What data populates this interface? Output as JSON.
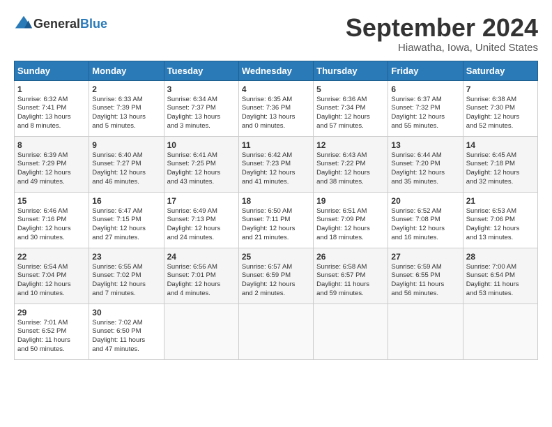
{
  "header": {
    "logo_general": "General",
    "logo_blue": "Blue",
    "month": "September 2024",
    "location": "Hiawatha, Iowa, United States"
  },
  "weekdays": [
    "Sunday",
    "Monday",
    "Tuesday",
    "Wednesday",
    "Thursday",
    "Friday",
    "Saturday"
  ],
  "weeks": [
    [
      {
        "day": "1",
        "line1": "Sunrise: 6:32 AM",
        "line2": "Sunset: 7:41 PM",
        "line3": "Daylight: 13 hours",
        "line4": "and 8 minutes."
      },
      {
        "day": "2",
        "line1": "Sunrise: 6:33 AM",
        "line2": "Sunset: 7:39 PM",
        "line3": "Daylight: 13 hours",
        "line4": "and 5 minutes."
      },
      {
        "day": "3",
        "line1": "Sunrise: 6:34 AM",
        "line2": "Sunset: 7:37 PM",
        "line3": "Daylight: 13 hours",
        "line4": "and 3 minutes."
      },
      {
        "day": "4",
        "line1": "Sunrise: 6:35 AM",
        "line2": "Sunset: 7:36 PM",
        "line3": "Daylight: 13 hours",
        "line4": "and 0 minutes."
      },
      {
        "day": "5",
        "line1": "Sunrise: 6:36 AM",
        "line2": "Sunset: 7:34 PM",
        "line3": "Daylight: 12 hours",
        "line4": "and 57 minutes."
      },
      {
        "day": "6",
        "line1": "Sunrise: 6:37 AM",
        "line2": "Sunset: 7:32 PM",
        "line3": "Daylight: 12 hours",
        "line4": "and 55 minutes."
      },
      {
        "day": "7",
        "line1": "Sunrise: 6:38 AM",
        "line2": "Sunset: 7:30 PM",
        "line3": "Daylight: 12 hours",
        "line4": "and 52 minutes."
      }
    ],
    [
      {
        "day": "8",
        "line1": "Sunrise: 6:39 AM",
        "line2": "Sunset: 7:29 PM",
        "line3": "Daylight: 12 hours",
        "line4": "and 49 minutes."
      },
      {
        "day": "9",
        "line1": "Sunrise: 6:40 AM",
        "line2": "Sunset: 7:27 PM",
        "line3": "Daylight: 12 hours",
        "line4": "and 46 minutes."
      },
      {
        "day": "10",
        "line1": "Sunrise: 6:41 AM",
        "line2": "Sunset: 7:25 PM",
        "line3": "Daylight: 12 hours",
        "line4": "and 43 minutes."
      },
      {
        "day": "11",
        "line1": "Sunrise: 6:42 AM",
        "line2": "Sunset: 7:23 PM",
        "line3": "Daylight: 12 hours",
        "line4": "and 41 minutes."
      },
      {
        "day": "12",
        "line1": "Sunrise: 6:43 AM",
        "line2": "Sunset: 7:22 PM",
        "line3": "Daylight: 12 hours",
        "line4": "and 38 minutes."
      },
      {
        "day": "13",
        "line1": "Sunrise: 6:44 AM",
        "line2": "Sunset: 7:20 PM",
        "line3": "Daylight: 12 hours",
        "line4": "and 35 minutes."
      },
      {
        "day": "14",
        "line1": "Sunrise: 6:45 AM",
        "line2": "Sunset: 7:18 PM",
        "line3": "Daylight: 12 hours",
        "line4": "and 32 minutes."
      }
    ],
    [
      {
        "day": "15",
        "line1": "Sunrise: 6:46 AM",
        "line2": "Sunset: 7:16 PM",
        "line3": "Daylight: 12 hours",
        "line4": "and 30 minutes."
      },
      {
        "day": "16",
        "line1": "Sunrise: 6:47 AM",
        "line2": "Sunset: 7:15 PM",
        "line3": "Daylight: 12 hours",
        "line4": "and 27 minutes."
      },
      {
        "day": "17",
        "line1": "Sunrise: 6:49 AM",
        "line2": "Sunset: 7:13 PM",
        "line3": "Daylight: 12 hours",
        "line4": "and 24 minutes."
      },
      {
        "day": "18",
        "line1": "Sunrise: 6:50 AM",
        "line2": "Sunset: 7:11 PM",
        "line3": "Daylight: 12 hours",
        "line4": "and 21 minutes."
      },
      {
        "day": "19",
        "line1": "Sunrise: 6:51 AM",
        "line2": "Sunset: 7:09 PM",
        "line3": "Daylight: 12 hours",
        "line4": "and 18 minutes."
      },
      {
        "day": "20",
        "line1": "Sunrise: 6:52 AM",
        "line2": "Sunset: 7:08 PM",
        "line3": "Daylight: 12 hours",
        "line4": "and 16 minutes."
      },
      {
        "day": "21",
        "line1": "Sunrise: 6:53 AM",
        "line2": "Sunset: 7:06 PM",
        "line3": "Daylight: 12 hours",
        "line4": "and 13 minutes."
      }
    ],
    [
      {
        "day": "22",
        "line1": "Sunrise: 6:54 AM",
        "line2": "Sunset: 7:04 PM",
        "line3": "Daylight: 12 hours",
        "line4": "and 10 minutes."
      },
      {
        "day": "23",
        "line1": "Sunrise: 6:55 AM",
        "line2": "Sunset: 7:02 PM",
        "line3": "Daylight: 12 hours",
        "line4": "and 7 minutes."
      },
      {
        "day": "24",
        "line1": "Sunrise: 6:56 AM",
        "line2": "Sunset: 7:01 PM",
        "line3": "Daylight: 12 hours",
        "line4": "and 4 minutes."
      },
      {
        "day": "25",
        "line1": "Sunrise: 6:57 AM",
        "line2": "Sunset: 6:59 PM",
        "line3": "Daylight: 12 hours",
        "line4": "and 2 minutes."
      },
      {
        "day": "26",
        "line1": "Sunrise: 6:58 AM",
        "line2": "Sunset: 6:57 PM",
        "line3": "Daylight: 11 hours",
        "line4": "and 59 minutes."
      },
      {
        "day": "27",
        "line1": "Sunrise: 6:59 AM",
        "line2": "Sunset: 6:55 PM",
        "line3": "Daylight: 11 hours",
        "line4": "and 56 minutes."
      },
      {
        "day": "28",
        "line1": "Sunrise: 7:00 AM",
        "line2": "Sunset: 6:54 PM",
        "line3": "Daylight: 11 hours",
        "line4": "and 53 minutes."
      }
    ],
    [
      {
        "day": "29",
        "line1": "Sunrise: 7:01 AM",
        "line2": "Sunset: 6:52 PM",
        "line3": "Daylight: 11 hours",
        "line4": "and 50 minutes."
      },
      {
        "day": "30",
        "line1": "Sunrise: 7:02 AM",
        "line2": "Sunset: 6:50 PM",
        "line3": "Daylight: 11 hours",
        "line4": "and 47 minutes."
      },
      {
        "day": "",
        "line1": "",
        "line2": "",
        "line3": "",
        "line4": ""
      },
      {
        "day": "",
        "line1": "",
        "line2": "",
        "line3": "",
        "line4": ""
      },
      {
        "day": "",
        "line1": "",
        "line2": "",
        "line3": "",
        "line4": ""
      },
      {
        "day": "",
        "line1": "",
        "line2": "",
        "line3": "",
        "line4": ""
      },
      {
        "day": "",
        "line1": "",
        "line2": "",
        "line3": "",
        "line4": ""
      }
    ]
  ]
}
